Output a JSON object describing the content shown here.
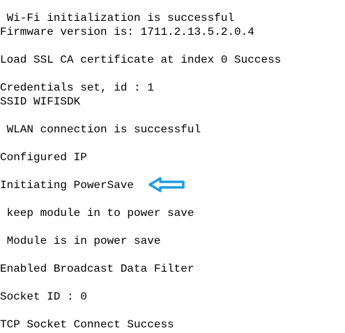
{
  "console": {
    "lines": [
      " Wi-Fi initialization is successful",
      "Firmware version is: 1711.2.13.5.2.0.4",
      "",
      "Load SSL CA certificate at index 0 Success",
      "",
      "Credentials set, id : 1",
      "SSID WIFISDK",
      "",
      " WLAN connection is successful",
      "",
      "Configured IP",
      "",
      "Initiating PowerSave",
      "",
      " keep module in to power save",
      "",
      " Module is in power save",
      "",
      "Enabled Broadcast Data Filter",
      "",
      "Socket ID : 0",
      "",
      "TCP Socket Connect Success"
    ]
  },
  "annotation": {
    "icon": "left-arrow-icon",
    "color": "#1e9be6"
  }
}
